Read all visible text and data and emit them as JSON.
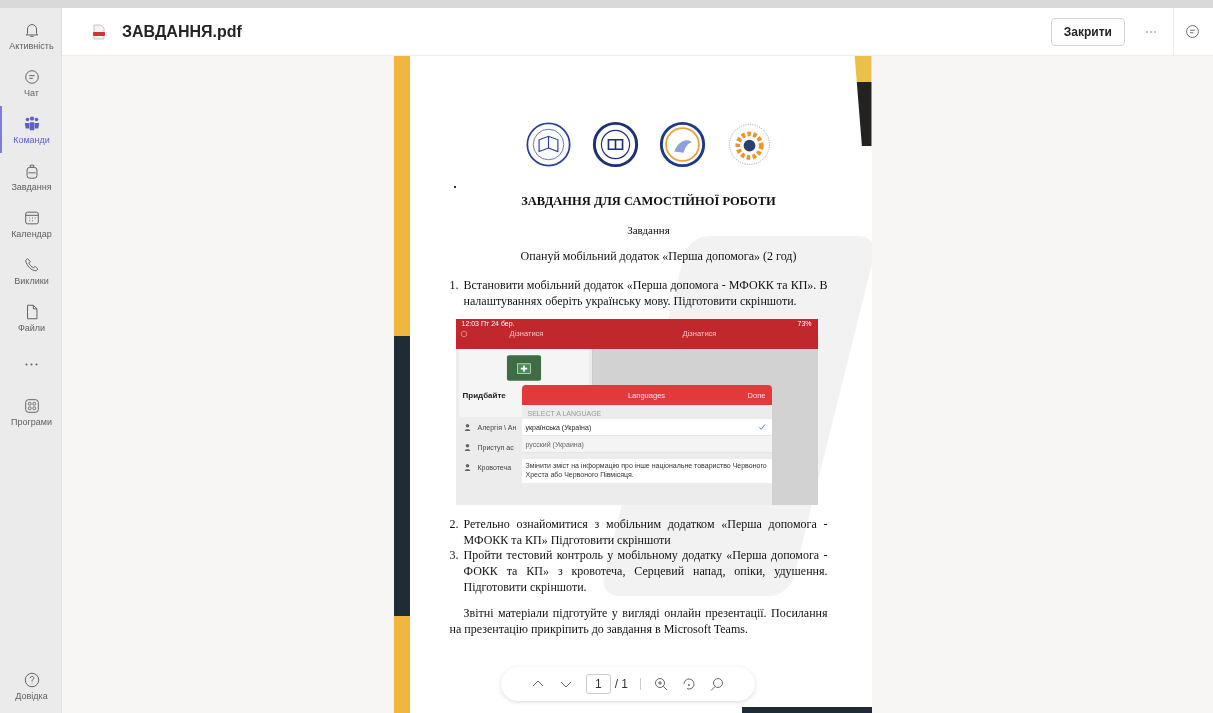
{
  "sidebar": {
    "items": [
      {
        "kind": "bell",
        "label": "Активність",
        "selected": false
      },
      {
        "kind": "chat",
        "label": "Чат",
        "selected": false
      },
      {
        "kind": "teams",
        "label": "Команди",
        "selected": true
      },
      {
        "kind": "backpack",
        "label": "Завдання",
        "selected": false
      },
      {
        "kind": "calendar",
        "label": "Календар",
        "selected": false
      },
      {
        "kind": "phone",
        "label": "Виклики",
        "selected": false
      },
      {
        "kind": "file",
        "label": "Файли",
        "selected": false
      },
      {
        "kind": "more",
        "selected": false
      },
      {
        "kind": "apps",
        "label": "Програми",
        "selected": false
      }
    ],
    "help": {
      "label": "Довідка"
    }
  },
  "header": {
    "title": "ЗАВДАННЯ.pdf",
    "close_button": "Закрити"
  },
  "document": {
    "heading": "ЗАВДАННЯ ДЛЯ САМОСТІЙНОЇ РОБОТИ",
    "subheading": "Завдання",
    "intro": "Опануй мобільний додаток «Перша допомога» (2 год)",
    "items": [
      {
        "number": "1.",
        "text": "Встановити мобільний додаток  «Перша допомога - МФОКК та КП». В налаштуваннях оберіть українську мову. Підготовити скріншоти."
      },
      {
        "number": "2.",
        "text": "Ретельно ознайомитися з мобільним додатком  «Перша допомога - МФОКК та КП» Підготовити скріншоти"
      },
      {
        "number": "3.",
        "text": "Пройти тестовий контроль у мобільному додатку  «Перша допомога - ФОКК та КП» з кровотеча, Серцевий напад, опіки, удушення. Підготовити скріншоти."
      }
    ],
    "note": "Звітні матеріали підготуйте у вигляді онлайн презентації. Посилання на презентацію прикріпить до завдання в Microsoft Teams.",
    "screenshot": {
      "status_time": "12:03  Пт 24 бер.",
      "battery": "73%",
      "left_title": "Дізнатися",
      "right_title": "Дізнатися",
      "card_title": "Придбайте",
      "list": [
        "Алергія \\ Ан",
        "Приступ ас",
        "Кровотеча"
      ],
      "dialog": {
        "title": "Languages",
        "done": "Done",
        "section": "SELECT A LANGUAGE",
        "options": [
          {
            "label": "українська (Україна)",
            "selected": true
          },
          {
            "label": "русский (Украина)",
            "selected": false
          }
        ],
        "footer": "Змінити зміст на інформацію про інше національне товариство Червоного Хреста або Червоного Півмісяця."
      }
    }
  },
  "pager": {
    "page": "1",
    "total": "/ 1"
  }
}
